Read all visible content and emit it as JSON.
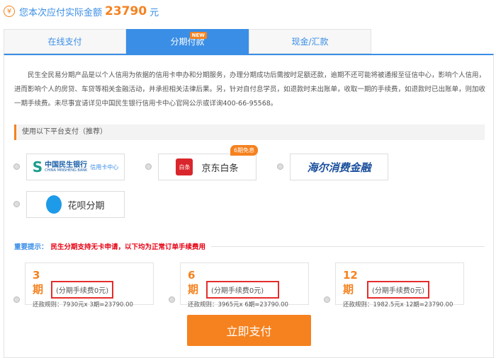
{
  "header": {
    "label": "您本次应付实际金额",
    "amount": "23790",
    "unit": "元",
    "icon": "yen-icon"
  },
  "tabs": [
    {
      "label": "在线支付"
    },
    {
      "label": "分期付款",
      "badge": "NEW",
      "active": true
    },
    {
      "label": "现金/汇款"
    }
  ],
  "notice": "民生全民易分期产品是以个人信用为依据的信用卡申办和分期服务，办理分期成功后需按时足额还款，逾期不还可能将被通报至征信中心，影响个人信用，进而影响个人的房贷、车贷等相关金融活动，并承担相关法律后果。另，针对自付息学员，如退款时未出账单，收取一期的手续费，如退款时已出账单，则加收一期手续费。未尽事宜请详见中国民生银行信用卡中心官网公示或详询400-66-95568。",
  "platform_section": "使用以下平台支付（推荐）",
  "platforms": [
    {
      "name": "中国民生银行",
      "sub": "CHINA MINSHENG BANK",
      "extra": "信用卡中心"
    },
    {
      "name": "京东白条",
      "icon_text": "白条",
      "badge": "6期免息"
    },
    {
      "name": "海尔消费金融"
    },
    {
      "name": "花呗分期"
    }
  ],
  "important": {
    "label": "重要提示：",
    "text": "民生分期支持无卡申请，以下均为正常订单手续费用"
  },
  "installments": [
    {
      "period": "3期",
      "fee": "(分期手续费0元)",
      "rule": "还款规则：7930元x 3期=23790.00"
    },
    {
      "period": "6期",
      "fee": "(分期手续费0元)",
      "rule": "还款规则：3965元x 6期=23790.00"
    },
    {
      "period": "12期",
      "fee": "(分期手续费0元)",
      "rule": "还款规则：1982.5元x 12期=23790.00"
    }
  ],
  "pay_button": "立即支付",
  "colors": {
    "accent": "#3a8ee6",
    "orange": "#f5821f",
    "red": "#e60012"
  }
}
